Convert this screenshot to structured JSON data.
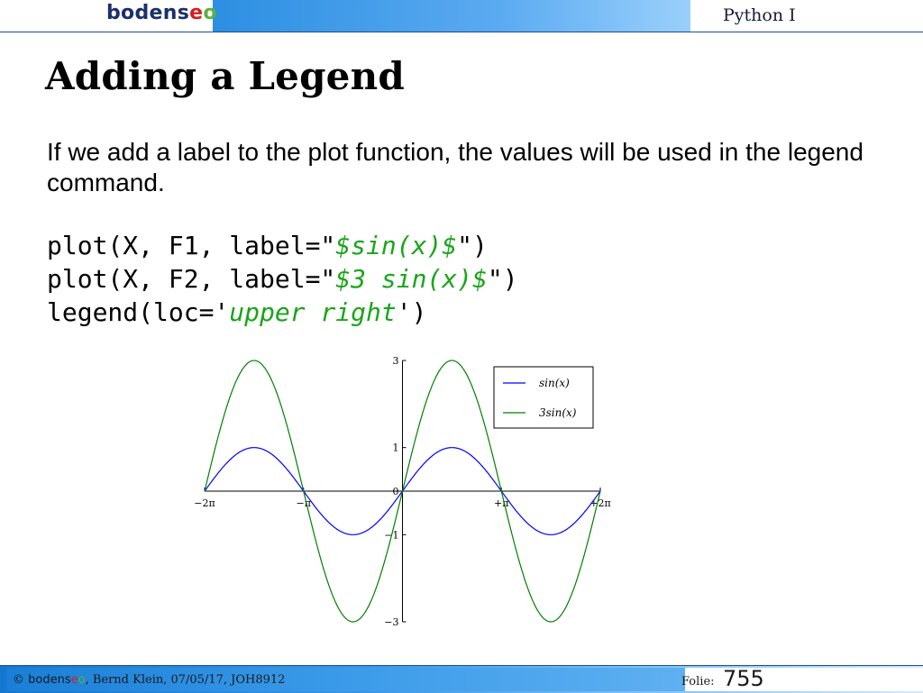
{
  "header": {
    "logo_part1": "bodens",
    "logo_part2": "e",
    "logo_part3": "o",
    "course": "Python I"
  },
  "slide": {
    "title": "Adding a Legend",
    "intro": "If we add a label to the plot function, the values will be used in the legend command.",
    "code": {
      "line1_prefix": "plot(X, F1, label=\"",
      "line1_str": "$sin(x)$",
      "line1_suffix": "\")",
      "line2_prefix": "plot(X, F2, label=\"",
      "line2_str": "$3 sin(x)$",
      "line2_suffix": "\")",
      "line3_prefix": "legend(loc='",
      "line3_str": "upper right",
      "line3_suffix": "')"
    }
  },
  "chart_data": {
    "type": "line",
    "xlim": [
      -6.2832,
      6.2832
    ],
    "ylim": [
      -3,
      3
    ],
    "x_ticks": [
      {
        "value": -6.2832,
        "label": "−2π"
      },
      {
        "value": -3.1416,
        "label": "−π"
      },
      {
        "value": 0,
        "label": "0"
      },
      {
        "value": 3.1416,
        "label": "+π"
      },
      {
        "value": 6.2832,
        "label": "+2π"
      }
    ],
    "y_ticks": [
      {
        "value": 3,
        "label": "3"
      },
      {
        "value": 1,
        "label": "1"
      },
      {
        "value": 0,
        "label": "0"
      },
      {
        "value": -1,
        "label": "−1"
      },
      {
        "value": -3,
        "label": "−3"
      }
    ],
    "series": [
      {
        "name": "sin(x)",
        "color": "#0000ff",
        "function": "sin",
        "amplitude": 1
      },
      {
        "name": "3sin(x)",
        "color": "#008000",
        "function": "sin",
        "amplitude": 3
      }
    ],
    "legend_placement": "upper right",
    "spines": "centered",
    "grid": false
  },
  "footer": {
    "copyright": "© ",
    "brand_part1": "bodens",
    "brand_part2": "e",
    "brand_part3": "o",
    "author_info": ", Bernd Klein, 07/05/17, JOH8912",
    "folie_label": "Folie:",
    "folie_number": "755"
  }
}
